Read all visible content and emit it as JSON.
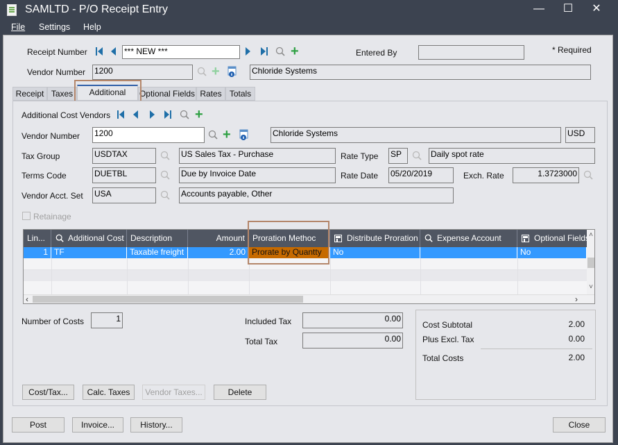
{
  "window": {
    "title": "SAMLTD - P/O Receipt Entry",
    "controls": {
      "minimize": "—",
      "maximize": "☐",
      "close": "✕"
    }
  },
  "menu": [
    {
      "label": "File",
      "accel": "F"
    },
    {
      "label": "Settings",
      "accel": ""
    },
    {
      "label": "Help",
      "accel": "H"
    }
  ],
  "header": {
    "receipt_number_label": "Receipt Number",
    "receipt_number_value": "*** NEW ***",
    "entered_by_label": "Entered By",
    "entered_by_value": "",
    "required_note": "*  Required",
    "vendor_number_label": "Vendor Number",
    "vendor_number_value": "1200",
    "vendor_name_value": "Chloride Systems"
  },
  "tabs": [
    {
      "label": "Receipt",
      "active": false
    },
    {
      "label": "Taxes",
      "active": false
    },
    {
      "label": "Additional Costs",
      "active": true
    },
    {
      "label": "Optional Fields",
      "active": false
    },
    {
      "label": "Rates",
      "active": false
    },
    {
      "label": "Totals",
      "active": false
    }
  ],
  "additional_costs": {
    "vendors_label": "Additional Cost Vendors",
    "vendor_number_label": "Vendor Number",
    "vendor_number_value": "1200",
    "vendor_name_value": "Chloride Systems",
    "currency_value": "USD",
    "tax_group_label": "Tax Group",
    "tax_group_value": "USDTAX",
    "tax_group_desc": "US Sales Tax - Purchase",
    "rate_type_label": "Rate Type",
    "rate_type_value": "SP",
    "rate_type_desc": "Daily spot rate",
    "terms_code_label": "Terms Code",
    "terms_code_value": "DUETBL",
    "terms_code_desc": "Due by Invoice Date",
    "rate_date_label": "Rate Date",
    "rate_date_value": "05/20/2019",
    "exch_rate_label": "Exch. Rate",
    "exch_rate_value": "1.3723000",
    "vendor_acct_set_label": "Vendor Acct. Set",
    "vendor_acct_set_value": "USA",
    "vendor_acct_set_desc": "Accounts payable, Other",
    "retainage_label": "Retainage",
    "retainage_checked": false
  },
  "grid": {
    "columns": [
      {
        "label": "Lin...",
        "icon": ""
      },
      {
        "label": "Additional Cost",
        "icon": "search-icon"
      },
      {
        "label": "Description",
        "icon": ""
      },
      {
        "label": "Amount",
        "icon": ""
      },
      {
        "label": "Proration Methoc",
        "icon": ""
      },
      {
        "label": "Distribute Proration",
        "icon": "detail-icon"
      },
      {
        "label": "Expense Account",
        "icon": "search-icon"
      },
      {
        "label": "Optional Fields",
        "icon": "detail-icon"
      }
    ],
    "rows": [
      {
        "line": "1",
        "additional_cost": "TF",
        "description": "Taxable freight",
        "amount": "2.00",
        "proration_method": "Prorate by Quantty",
        "distribute_proration": "No",
        "expense_account": "",
        "optional_fields": "No"
      }
    ],
    "selected_color": "#3399ff",
    "edit_cell_color": "#c66a00"
  },
  "summary": {
    "number_of_costs_label": "Number of Costs",
    "number_of_costs_value": "1",
    "included_tax_label": "Included Tax",
    "included_tax_value": "0.00",
    "total_tax_label": "Total Tax",
    "total_tax_value": "0.00",
    "cost_subtotal_label": "Cost Subtotal",
    "cost_subtotal_value": "2.00",
    "plus_excl_tax_label": "Plus Excl. Tax",
    "plus_excl_tax_value": "0.00",
    "total_costs_label": "Total Costs",
    "total_costs_value": "2.00"
  },
  "panel_buttons": {
    "cost_tax": "Cost/Tax...",
    "calc_taxes": "Calc. Taxes",
    "vendor_taxes": "Vendor Taxes...",
    "delete": "Delete"
  },
  "footer_buttons": {
    "post": "Post",
    "invoice": "Invoice...",
    "history": "History...",
    "close": "Close"
  }
}
